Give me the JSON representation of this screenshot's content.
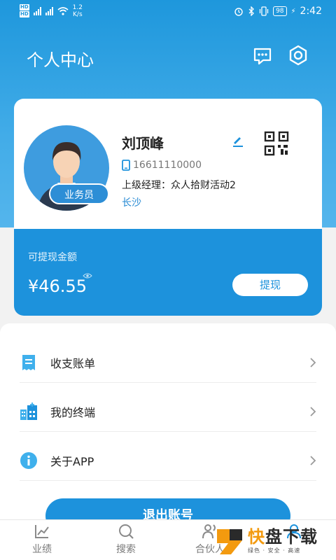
{
  "status_bar": {
    "speed_value": "1.2",
    "speed_unit": "K/s",
    "battery": "98",
    "time": "2:42"
  },
  "header": {
    "title": "个人中心",
    "message_icon": "message-dots-icon",
    "settings_icon": "gear-icon"
  },
  "profile": {
    "name": "刘顶峰",
    "role": "业务员",
    "phone": "16611110000",
    "manager_label": "上级经理：",
    "manager_value": "众人拾财活动2",
    "city": "长沙"
  },
  "balance": {
    "label": "可提现金额",
    "amount": "¥46.55",
    "withdraw_label": "提现"
  },
  "menu": {
    "items": [
      {
        "label": "收支账单",
        "icon": "bill-icon"
      },
      {
        "label": "我的终端",
        "icon": "terminal-building-icon"
      },
      {
        "label": "关于APP",
        "icon": "info-icon"
      }
    ]
  },
  "logout": {
    "label": "退出账号"
  },
  "tabbar": {
    "tabs": [
      {
        "label": "业绩",
        "icon": "chart-icon"
      },
      {
        "label": "搜索",
        "icon": "search-icon"
      },
      {
        "label": "合伙人",
        "icon": "partner-icon"
      },
      {
        "label": "",
        "icon": "my-icon"
      }
    ]
  },
  "watermark": {
    "brand_part1": "快",
    "brand_part2": "盘下载",
    "slogan": "绿色 · 安全 · 高速"
  },
  "colors": {
    "primary": "#1d92dc",
    "accent": "#f39a0f"
  }
}
